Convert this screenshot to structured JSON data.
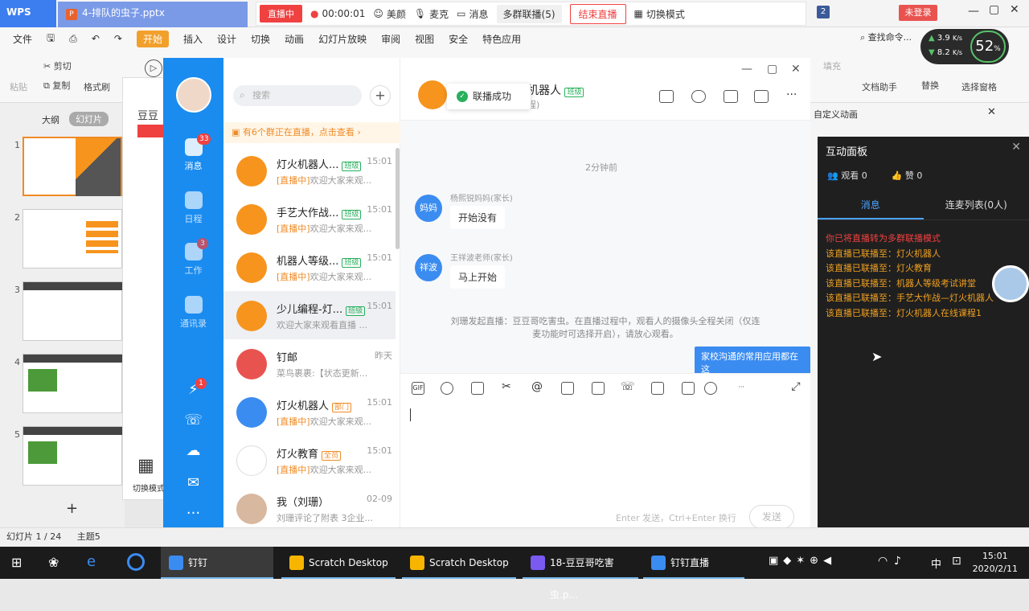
{
  "wps": {
    "logo": "WPS",
    "doc_tab": "4-排队的虫子.pptx",
    "menu": [
      "文件",
      "开始",
      "插入",
      "设计",
      "切换",
      "动画",
      "幻灯片放映",
      "审阅",
      "视图",
      "安全",
      "特色应用"
    ],
    "search": "查找命令...",
    "ribbon": {
      "cut": "剪切",
      "copy": "复制",
      "paste": "粘贴",
      "format_painter": "格式刷",
      "doc_helper": "文档助手",
      "find": "查找",
      "replace": "替换",
      "select_pane": "选择窗格",
      "fill": "填充"
    },
    "panel_tabs": [
      "大纲",
      "幻灯片"
    ],
    "slide_title_partial": "豆豆哥",
    "switch_mode": "切换模式",
    "custom_anim": "自定义动画",
    "status": {
      "slide": "幻灯片 1 / 24",
      "theme": "主题5"
    }
  },
  "live_bar": {
    "badge": "直播中",
    "timer": "00:00:01",
    "beauty": "美颜",
    "mic": "麦克",
    "message": "消息",
    "multi_group": "多群联播(5)",
    "end_live": "结束直播",
    "switch_mode": "切换模式",
    "count": "2",
    "login": "未登录"
  },
  "speed": {
    "up": "3.9",
    "down": "8.2",
    "unit": "K/s",
    "percent": "52"
  },
  "interaction": {
    "title": "互动面板",
    "viewers": "观看 0",
    "likes": "赞 0",
    "tabs": [
      "消息",
      "连麦列表(0人)"
    ],
    "log": [
      {
        "text": "你已将直播转为多群联播模式",
        "color": "#f04141"
      },
      {
        "text": "该直播已联播至：灯火机器人",
        "color": "#f0a020"
      },
      {
        "text": "该直播已联播至：灯火教育",
        "color": "#f0a020"
      },
      {
        "text": "该直播已联播至：机器人等级考试讲堂",
        "color": "#f0a020"
      },
      {
        "text": "该直播已联播至：手艺大作战—灯火机器人",
        "color": "#f0a020"
      },
      {
        "text": "该直播已联播至：灯火机器人在线课程1",
        "color": "#f0a020"
      }
    ]
  },
  "dingtalk": {
    "nav": [
      {
        "label": "消息",
        "badge": "33"
      },
      {
        "label": "日程",
        "badge": ""
      },
      {
        "label": "工作",
        "badge": "3"
      },
      {
        "label": "通讯录",
        "badge": ""
      }
    ],
    "nav_extra_badge": "1",
    "search_placeholder": "搜索",
    "notice": "有6个群正在直播，点击查看",
    "conversations": [
      {
        "name": "灯火机器人...",
        "tag": "班级",
        "time": "15:01",
        "live": "[直播中]",
        "msg": "欢迎大家来观...",
        "avatar": "#f7941d"
      },
      {
        "name": "手艺大作战...",
        "tag": "班级",
        "time": "15:01",
        "live": "[直播中]",
        "msg": "欢迎大家来观...",
        "avatar": "#f7941d"
      },
      {
        "name": "机器人等级...",
        "tag": "班级",
        "time": "15:01",
        "live": "[直播中]",
        "msg": "欢迎大家来观...",
        "avatar": "#f7941d"
      },
      {
        "name": "少儿编程-灯...",
        "tag": "班级",
        "time": "15:01",
        "live": "",
        "msg": "欢迎大家来观看直播 ...",
        "avatar": "#f7941d"
      },
      {
        "name": "钉邮",
        "tag": "",
        "time": "昨天",
        "live": "",
        "msg": "菜鸟裹裹:【状态更新...",
        "avatar": "#e9534f"
      },
      {
        "name": "灯火机器人",
        "tag": "部门",
        "time": "15:01",
        "live": "[直播中]",
        "msg": "欢迎大家来观...",
        "avatar": "#3b8cf0"
      },
      {
        "name": "灯火教育",
        "tag": "全员",
        "time": "15:01",
        "live": "[直播中]",
        "msg": "欢迎大家来观...",
        "avatar": "#ffffff"
      },
      {
        "name": "我（刘珊）",
        "tag": "",
        "time": "02-09",
        "live": "",
        "msg": "刘珊评论了附表 3企业...",
        "avatar": "#d9b8a0"
      }
    ],
    "chat": {
      "toast": "联播成功",
      "title_partial": "机器人",
      "title_tag": "班级",
      "subtitle_partial": "程)",
      "time_label": "2分钟前",
      "messages": [
        {
          "avatar": "妈妈",
          "sender": "杨熙锐妈妈(家长)",
          "text": "开始没有"
        },
        {
          "avatar": "祥波",
          "sender": "王祥波老师(家长)",
          "text": "马上开始"
        }
      ],
      "system_note": "刘珊发起直播：豆豆哥吃害虫。在直播过程中，观看人的摄像头全程关闭（仅连麦功能时可选择开启），请放心观看。",
      "tip": "家校沟通的常用应用都在这",
      "input_hint": "Enter 发送，Ctrl+Enter 换行",
      "send": "发送"
    }
  },
  "taskbar": {
    "items": [
      {
        "label": "钉钉",
        "color": "#3b8cf0"
      },
      {
        "label": "Scratch Desktop",
        "color": "#f7b500"
      },
      {
        "label": "Scratch Desktop",
        "color": "#f7b500"
      },
      {
        "label": "18-豆豆哥吃害虫.p...",
        "color": "#7a5af0"
      },
      {
        "label": "钉钉直播",
        "color": "#3b8cf0"
      }
    ],
    "ime": "中",
    "time": "15:01",
    "date": "2020/2/11"
  }
}
